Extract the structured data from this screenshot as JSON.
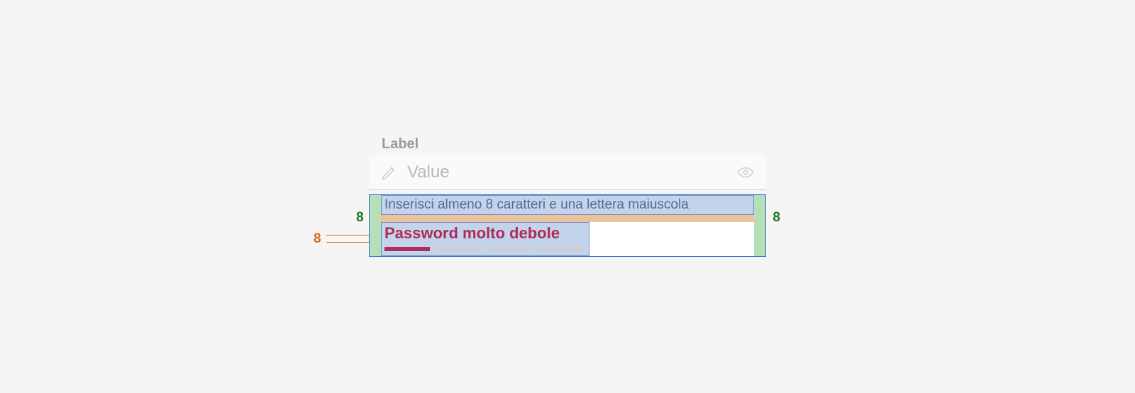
{
  "field": {
    "label": "Label",
    "placeholder": "Value"
  },
  "helper": {
    "text": "Inserisci almeno 8 caratteri e una lettera maiuscola"
  },
  "strength": {
    "text": "Password molto debole",
    "active_bars": 1,
    "total_bars": 4
  },
  "annotations": {
    "pad_left": "8",
    "pad_right": "8",
    "gap_vertical": "8"
  }
}
